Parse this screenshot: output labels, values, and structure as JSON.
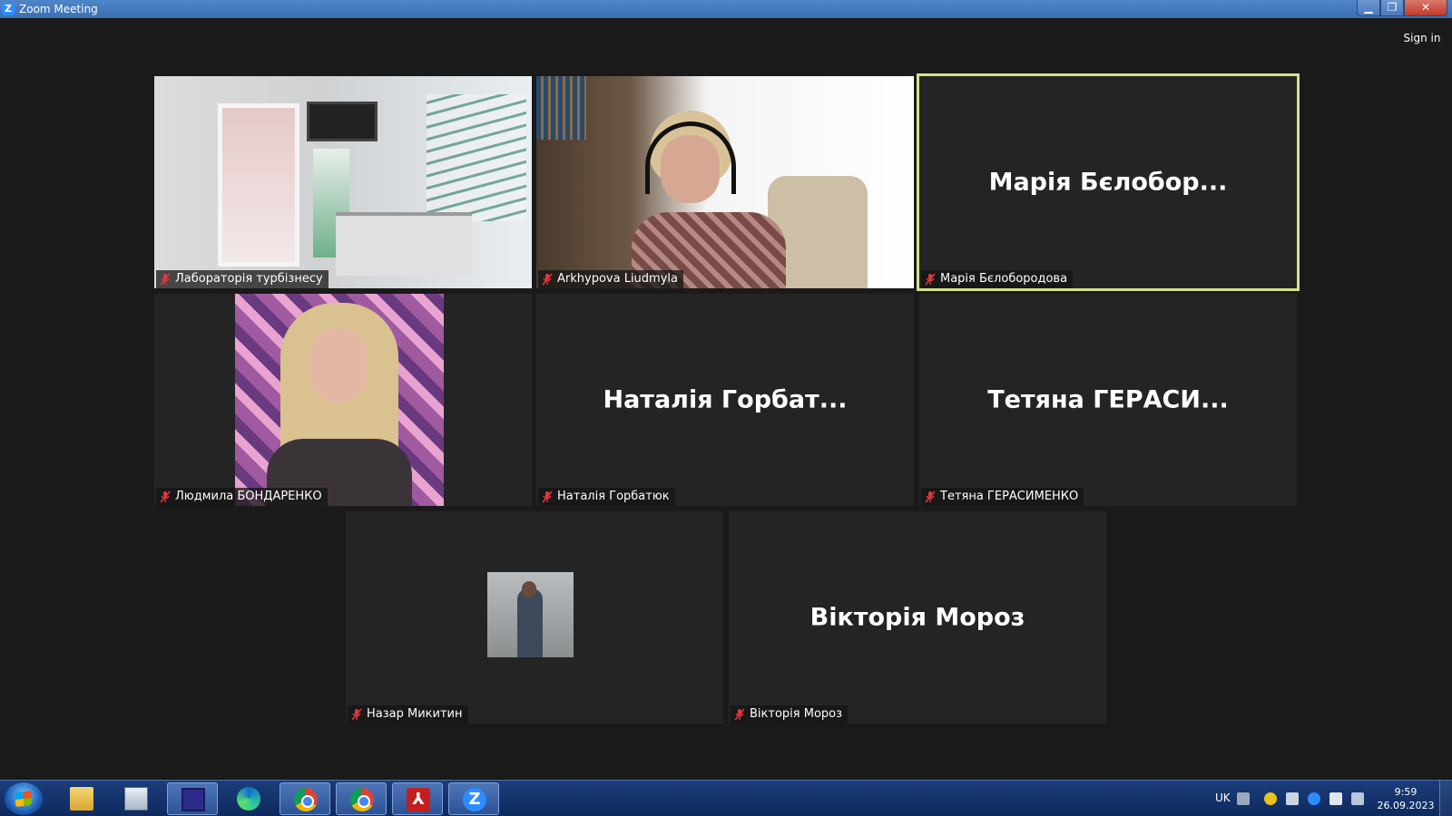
{
  "window": {
    "title": "Zoom Meeting",
    "sign_in": "Sign in"
  },
  "participants": [
    {
      "display_name": "Лабораторія турбізнесу",
      "label": "Лабораторія турбізнесу",
      "muted": true,
      "video": "lab"
    },
    {
      "display_name": "Arkhypova Liudmyla",
      "label": "Arkhypova Liudmyla",
      "muted": true,
      "video": "office"
    },
    {
      "display_name": "Марія Бєлобор...",
      "label": "Марія Бєлобородова",
      "muted": true,
      "active": true
    },
    {
      "display_name": "Людмила БОНДАРЕНКО",
      "label": "Людмила БОНДАРЕНКО",
      "muted": true,
      "video": "avatar"
    },
    {
      "display_name": "Наталія Горбат...",
      "label": "Наталія Горбатюк",
      "muted": true
    },
    {
      "display_name": "Тетяна ГЕРАСИ...",
      "label": "Тетяна ГЕРАСИМЕНКО",
      "muted": true
    },
    {
      "display_name": "Назар Микитин",
      "label": "Назар Микитин",
      "muted": true,
      "video": "small-avatar"
    },
    {
      "display_name": "Вікторія Мороз",
      "label": "Вікторія Мороз",
      "muted": true
    }
  ],
  "colors": {
    "active_speaker": "#d2e38a",
    "muted_icon": "#e0383e",
    "tile_bg": "#242424"
  },
  "taskbar": {
    "apps": [
      "windows-explorer-icon",
      "calculator-icon",
      "save-icon",
      "edge-icon",
      "chrome-icon",
      "chrome-icon",
      "acrobat-icon",
      "zoom-icon"
    ],
    "tray": {
      "language": "UK"
    },
    "clock": {
      "time": "9:59",
      "date": "26.09.2023"
    }
  }
}
